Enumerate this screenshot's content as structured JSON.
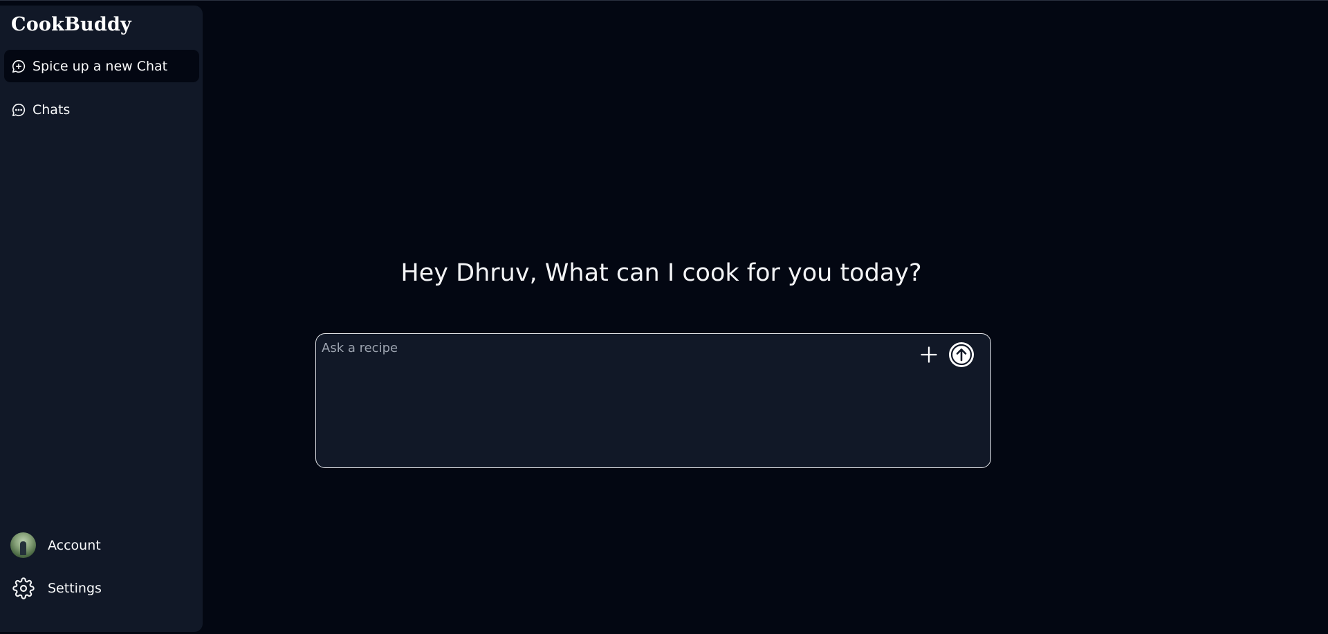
{
  "app": {
    "brand": "CookBuddy"
  },
  "sidebar": {
    "items": [
      {
        "label": "Spice up a new Chat",
        "icon": "message-plus-icon",
        "active": true
      },
      {
        "label": "Chats",
        "icon": "message-dots-icon",
        "active": false
      }
    ],
    "bottom": [
      {
        "label": "Account",
        "icon": "avatar"
      },
      {
        "label": "Settings",
        "icon": "gear-icon"
      }
    ]
  },
  "main": {
    "greeting": "Hey Dhruv, What can I cook for you today?",
    "composer": {
      "placeholder": "Ask a recipe",
      "value": "",
      "attach_icon": "plus-icon",
      "send_icon": "arrow-up-circle-icon"
    }
  },
  "colors": {
    "background": "#030712",
    "sidebar": "#111827",
    "text": "#f3f4f6",
    "placeholder": "#9ca3af",
    "composer_border": "#e5e7eb"
  }
}
